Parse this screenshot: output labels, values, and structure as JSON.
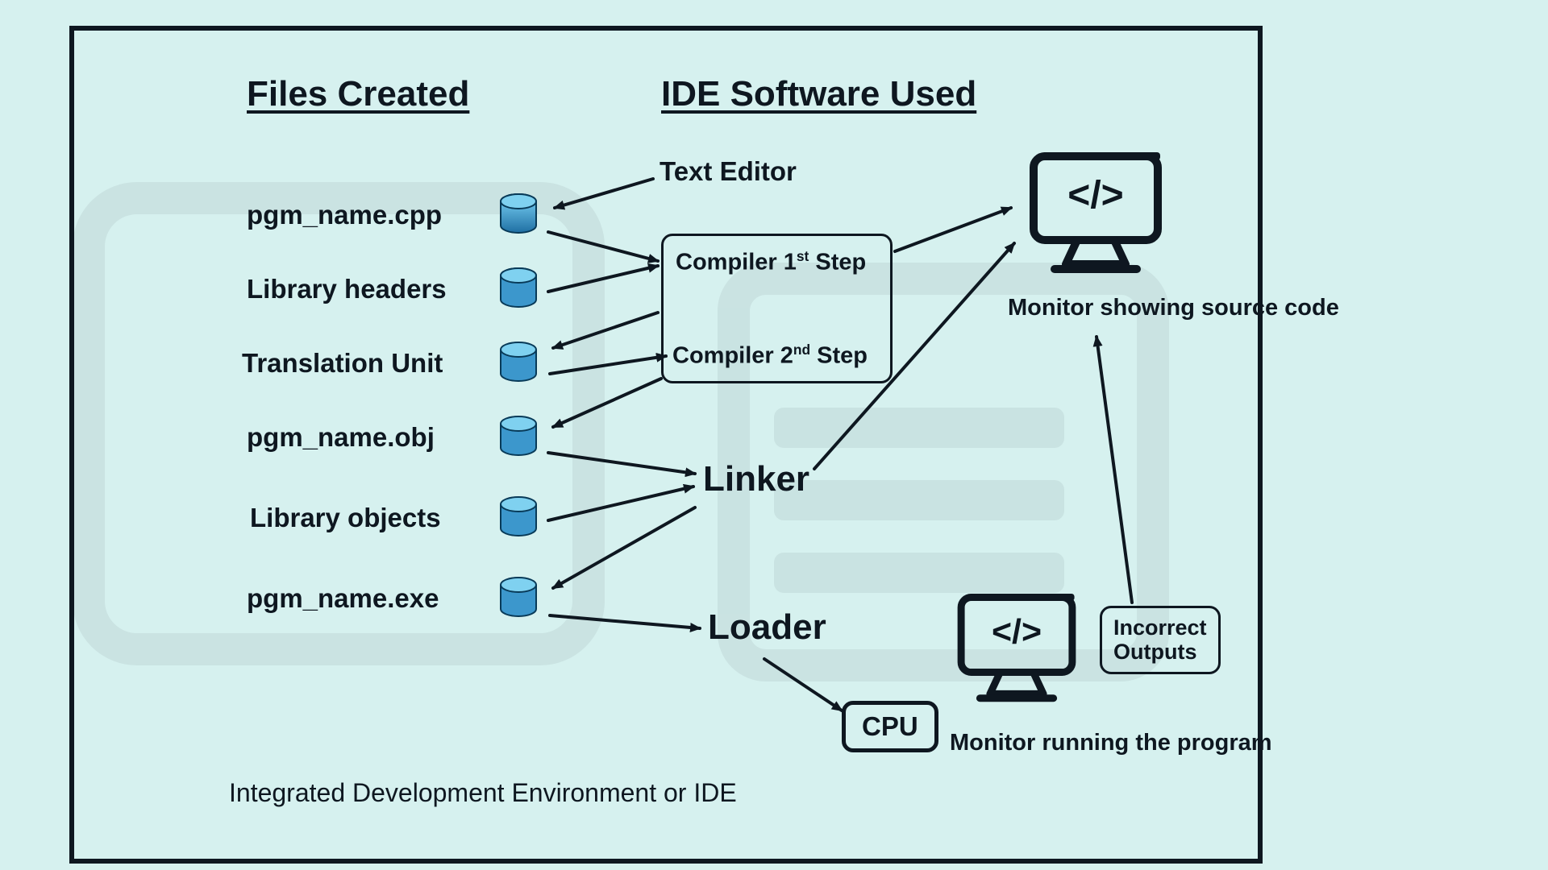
{
  "headings": {
    "files_created": "Files Created",
    "ide_software_used": "IDE Software Used"
  },
  "files": {
    "f1": "pgm_name.cpp",
    "f2": "Library headers",
    "f3": "Translation Unit",
    "f4": "pgm_name.obj",
    "f5": "Library objects",
    "f6": "pgm_name.exe"
  },
  "ide": {
    "text_editor": "Text Editor",
    "compiler_step1_prefix": "Compiler 1",
    "compiler_step1_sup": "st",
    "compiler_step1_suffix": " Step",
    "compiler_step2_prefix": "Compiler 2",
    "compiler_step2_sup": "nd",
    "compiler_step2_suffix": " Step",
    "linker": "Linker",
    "loader": "Loader",
    "cpu": "CPU"
  },
  "monitors": {
    "top_caption": "Monitor showing source code",
    "bottom_caption": "Monitor running the program"
  },
  "incorrect_outputs_l1": "Incorrect",
  "incorrect_outputs_l2": "Outputs",
  "footer": "Integrated Development Environment or IDE",
  "icon_names": {
    "db": "database-cylinder-icon",
    "monitor": "monitor-code-icon"
  },
  "colors": {
    "bg": "#d6f1ef",
    "ink": "#0e1720",
    "cyl_light": "#4aa8d8",
    "cyl_dark": "#1f6fa3"
  }
}
